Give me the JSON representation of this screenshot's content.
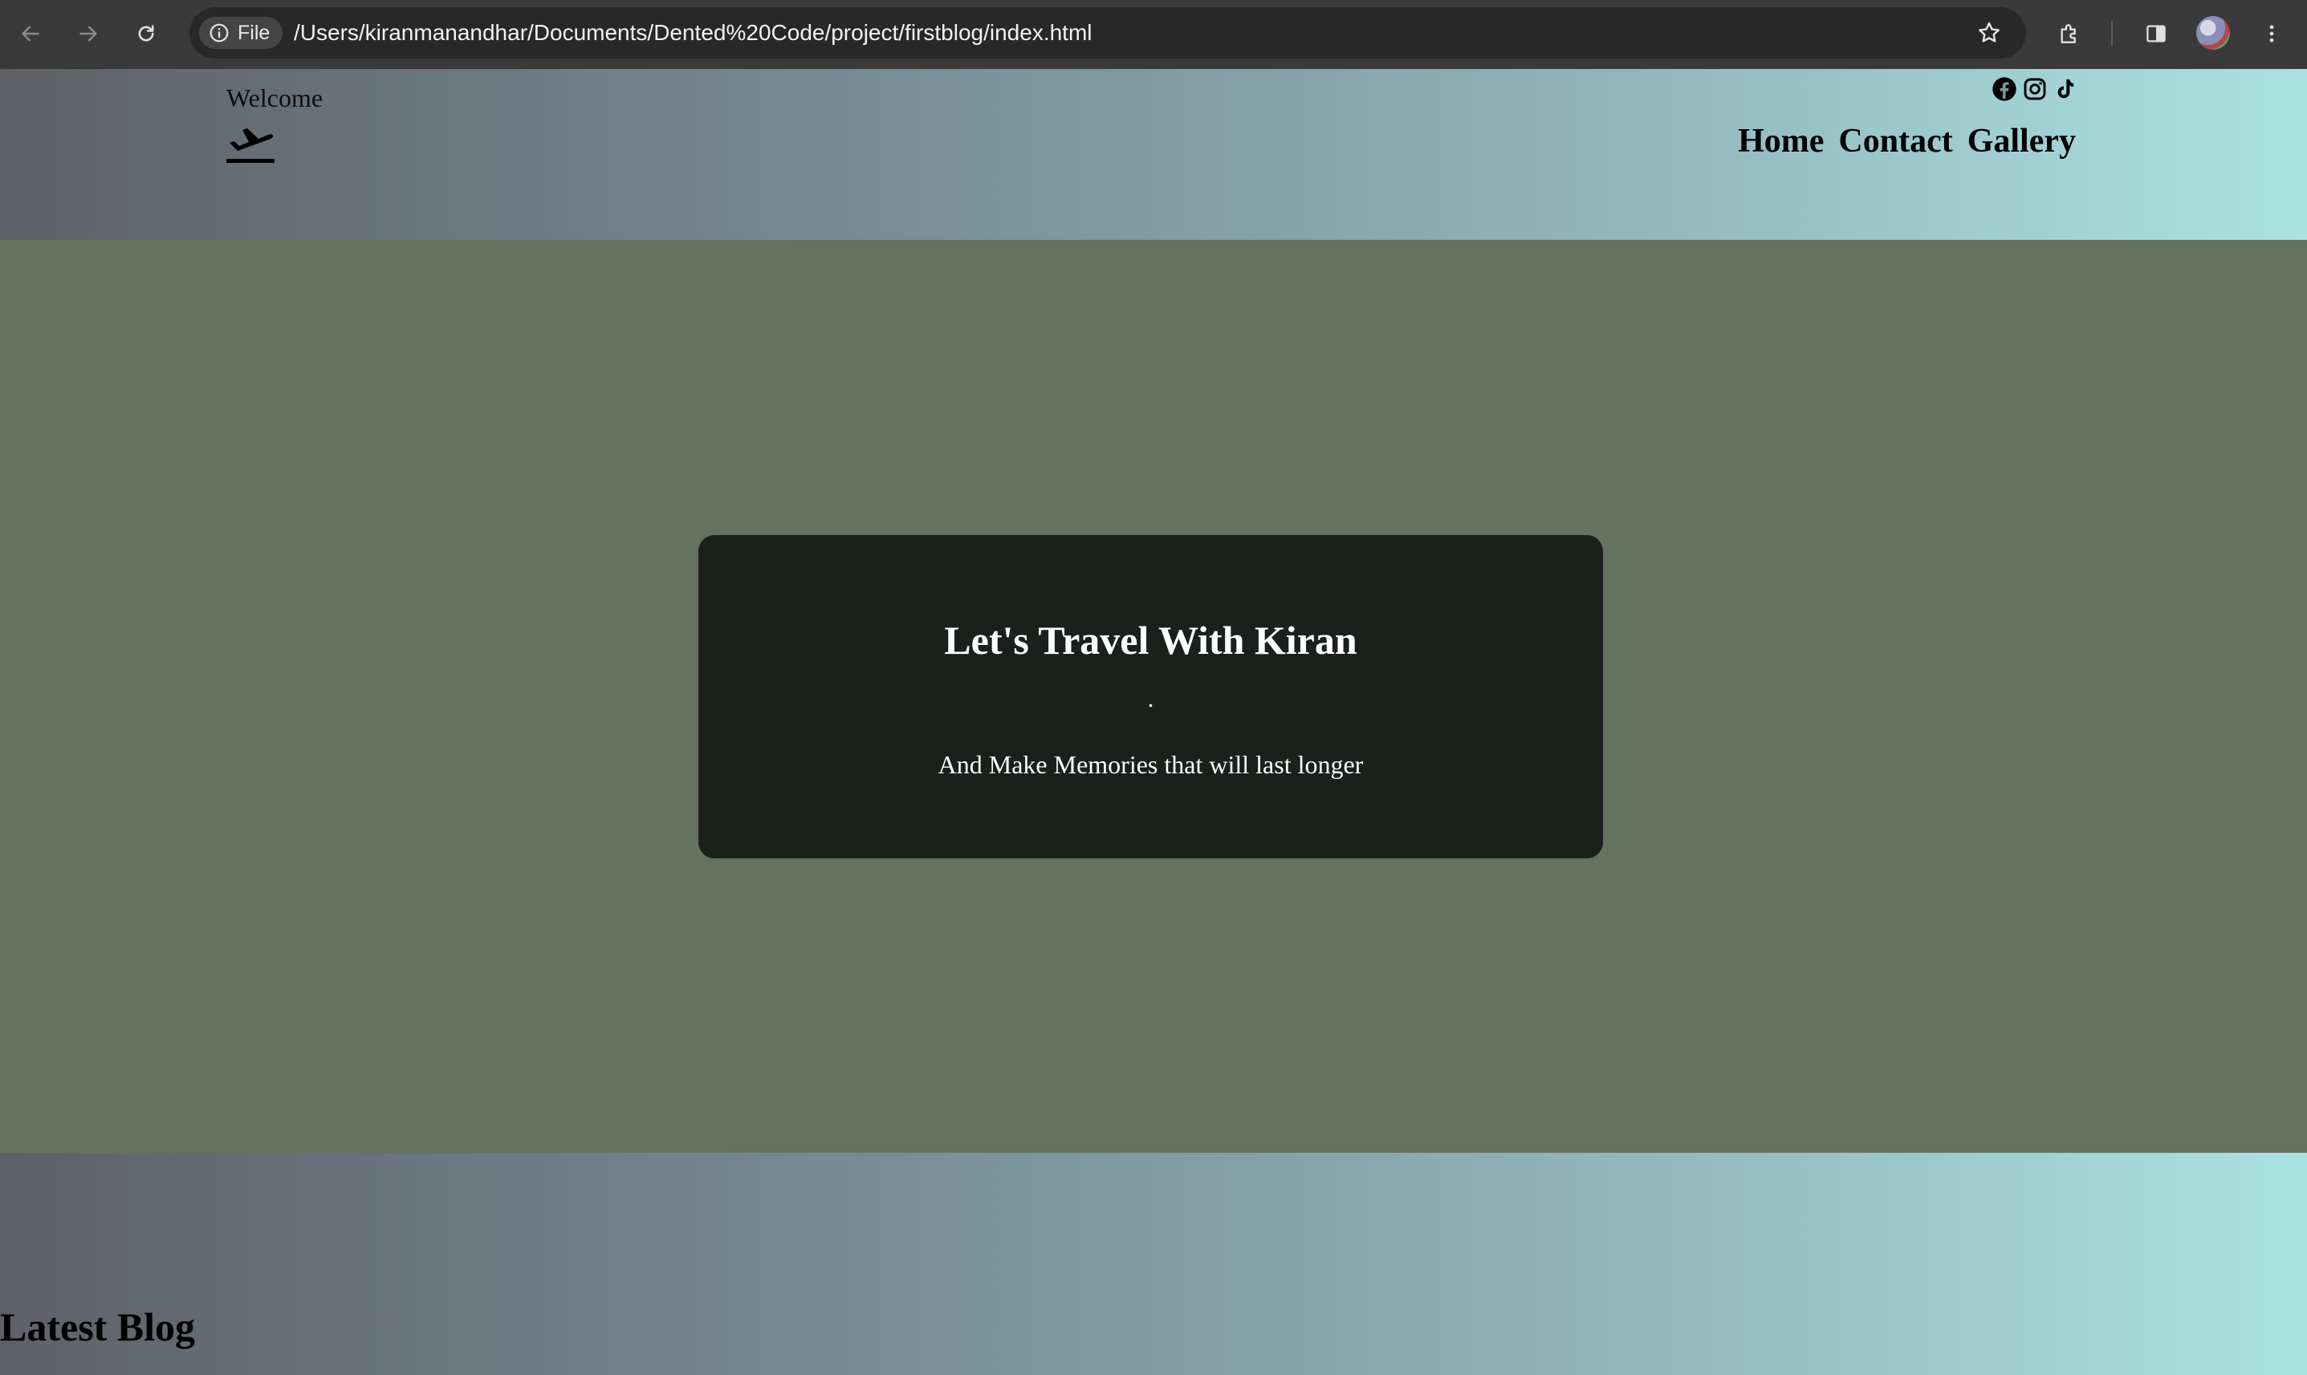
{
  "browser": {
    "file_chip_label": "File",
    "url": "/Users/kiranmanandhar/Documents/Dented%20Code/project/firstblog/index.html"
  },
  "header": {
    "welcome": "Welcome",
    "nav": [
      {
        "label": "Home"
      },
      {
        "label": "Contact"
      },
      {
        "label": "Gallery"
      }
    ],
    "socials": [
      "facebook-icon",
      "instagram-icon",
      "tiktok-icon"
    ]
  },
  "hero": {
    "title": "Let's Travel With Kiran",
    "dot": ".",
    "subtitle": "And Make Memories that will last longer"
  },
  "blog": {
    "heading": "Latest Blog"
  },
  "colors": {
    "hero_bg": "#637360",
    "card_bg": "#1c201c",
    "gradient_start": "#606068",
    "gradient_end": "#aae2e4"
  }
}
